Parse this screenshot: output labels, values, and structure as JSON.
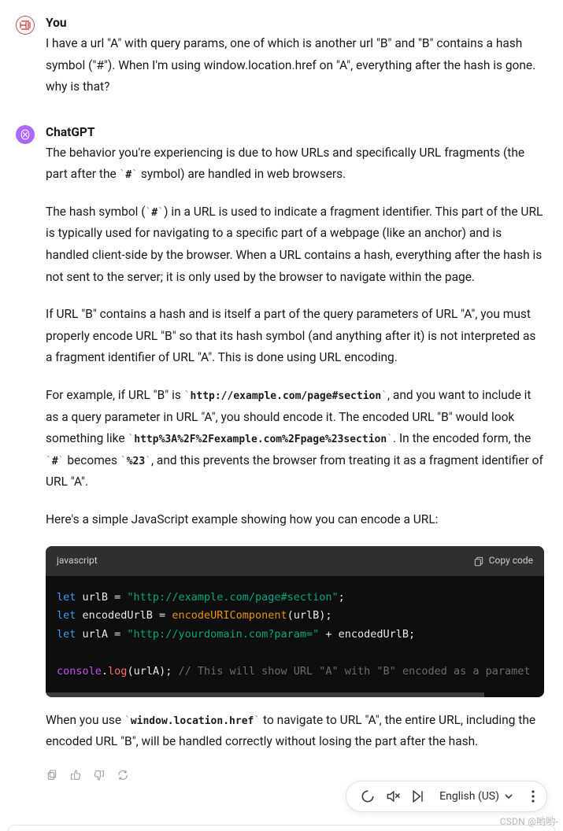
{
  "user": {
    "author": "You",
    "message": "I have a url \"A\" with query params, one of which is another url \"B\" and \"B\" contains a hash symbol (\"#\"). When I'm using window.location.href on \"A\", everything after the hash is gone. why is that?"
  },
  "assistant": {
    "author": "ChatGPT",
    "p1_a": "The behavior you're experiencing is due to how URLs and specifically URL fragments (the part after the ",
    "p1_code": "#",
    "p1_b": " symbol) are handled in web browsers.",
    "p2_a": "The hash symbol (",
    "p2_code": "#",
    "p2_b": ") in a URL is used to indicate a fragment identifier. This part of the URL is typically used for navigating to a specific part of a webpage (like an anchor) and is handled client-side by the browser. When a URL contains a hash, everything after the hash is not sent to the server; it is only used by the browser to navigate within the page.",
    "p3": "If URL \"B\" contains a hash and is itself a part of the query parameters of URL \"A\", you must properly encode URL \"B\" so that its hash symbol (and anything after it) is not interpreted as a fragment identifier of URL \"A\". This is done using URL encoding.",
    "p4_a": "For example, if URL \"B\" is ",
    "p4_code1": "http://example.com/page#section",
    "p4_b": ", and you want to include it as a query parameter in URL \"A\", you should encode it. The encoded URL \"B\" would look something like ",
    "p4_code2": "http%3A%2F%2Fexample.com%2Fpage%23section",
    "p4_c": ". In the encoded form, the ",
    "p4_code3": "#",
    "p4_d": " becomes ",
    "p4_code4": "%23",
    "p4_e": ", and this prevents the browser from treating it as a fragment identifier of URL \"A\".",
    "p5": "Here's a simple JavaScript example showing how you can encode a URL:",
    "code_lang": "javascript",
    "copy_label": "Copy code",
    "code": {
      "l1_kw": "let",
      "l1_var": " urlB = ",
      "l1_str": "\"http://example.com/page#section\"",
      "l1_end": ";",
      "l2_kw": "let",
      "l2_var": " encodedUrlB = ",
      "l2_fn": "encodeURIComponent",
      "l2_args": "(urlB);",
      "l3_kw": "let",
      "l3_var": " urlA = ",
      "l3_str": "\"http://yourdomain.com?param=\"",
      "l3_rest": " + encodedUrlB;",
      "l5_obj": "console",
      "l5_dot": ".",
      "l5_method": "log",
      "l5_args": "(urlA); ",
      "l5_comment": "// This will show URL \"A\" with \"B\" encoded as a paramet"
    },
    "p6_a": "When you use ",
    "p6_code": "window.location.href",
    "p6_b": " to navigate to URL \"A\", the entire URL, including the encoded URL \"B\", will be handled correctly without losing the part after the hash."
  },
  "bottom_bar": {
    "language": "English (US)"
  },
  "watermark": "CSDN @哟哟-"
}
